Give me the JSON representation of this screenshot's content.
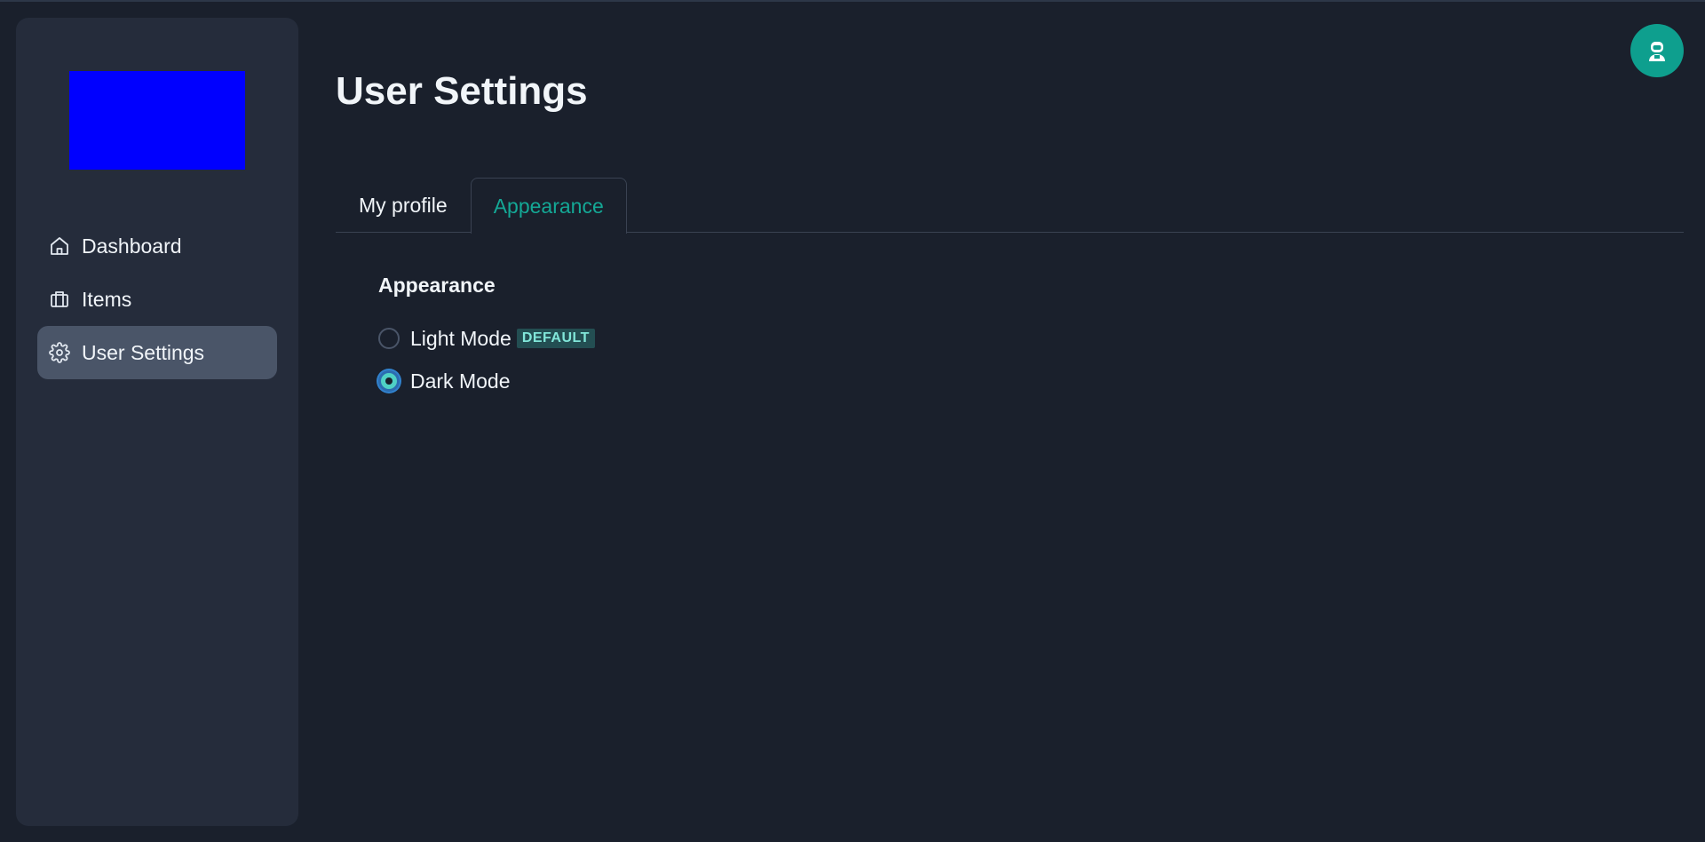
{
  "sidebar": {
    "items": [
      {
        "label": "Dashboard",
        "icon": "home-icon"
      },
      {
        "label": "Items",
        "icon": "briefcase-icon"
      },
      {
        "label": "User Settings",
        "icon": "gear-icon"
      }
    ]
  },
  "header": {
    "title": "User Settings",
    "avatar_icon": "user-avatar-icon"
  },
  "tabs": [
    {
      "label": "My profile"
    },
    {
      "label": "Appearance"
    }
  ],
  "appearance": {
    "title": "Appearance",
    "options": [
      {
        "label": "Light Mode",
        "badge": "DEFAULT",
        "selected": false
      },
      {
        "label": "Dark Mode",
        "selected": true
      }
    ]
  },
  "colors": {
    "background": "#1a202c",
    "sidebar": "#252c3b",
    "active_nav": "#4a5568",
    "accent": "#14a896",
    "logo": "#0000ff",
    "avatar": "#0e9f8e"
  }
}
